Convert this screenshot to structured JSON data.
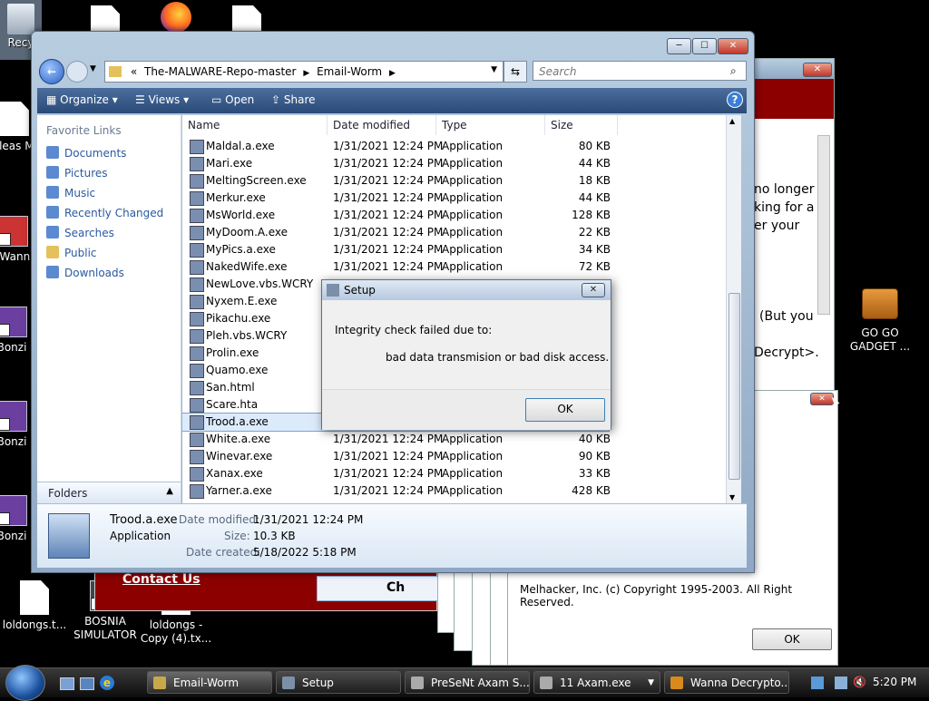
{
  "desktop": {
    "recycle_label": "Recy",
    "icons": [
      {
        "label": "!Pleas Me"
      },
      {
        "label": "!Wann"
      },
      {
        "label": "Bonzi"
      },
      {
        "label": "Bonzi"
      },
      {
        "label": "Bonzi"
      },
      {
        "label": "loldongs.t..."
      },
      {
        "label": "BOSNIA SIMULATOR"
      },
      {
        "label": "loldongs - Copy (4).tx..."
      },
      {
        "label": "GO GO GADGET ..."
      }
    ]
  },
  "explorer": {
    "breadcrumb": [
      "The-MALWARE-Repo-master",
      "Email-Worm"
    ],
    "search_placeholder": "Search",
    "toolbar": [
      "Organize",
      "Views",
      "Open",
      "Share"
    ],
    "favorite_links_title": "Favorite Links",
    "favorites": [
      "Documents",
      "Pictures",
      "Music",
      "Recently Changed",
      "Searches",
      "Public",
      "Downloads"
    ],
    "folders_label": "Folders",
    "columns": [
      "Name",
      "Date modified",
      "Type",
      "Size"
    ],
    "files": [
      {
        "name": "Maldal.a.exe",
        "date": "1/31/2021 12:24 PM",
        "type": "Application",
        "size": "80 KB"
      },
      {
        "name": "Mari.exe",
        "date": "1/31/2021 12:24 PM",
        "type": "Application",
        "size": "44 KB"
      },
      {
        "name": "MeltingScreen.exe",
        "date": "1/31/2021 12:24 PM",
        "type": "Application",
        "size": "18 KB"
      },
      {
        "name": "Merkur.exe",
        "date": "1/31/2021 12:24 PM",
        "type": "Application",
        "size": "44 KB"
      },
      {
        "name": "MsWorld.exe",
        "date": "1/31/2021 12:24 PM",
        "type": "Application",
        "size": "128 KB"
      },
      {
        "name": "MyDoom.A.exe",
        "date": "1/31/2021 12:24 PM",
        "type": "Application",
        "size": "22 KB"
      },
      {
        "name": "MyPics.a.exe",
        "date": "1/31/2021 12:24 PM",
        "type": "Application",
        "size": "34 KB"
      },
      {
        "name": "NakedWife.exe",
        "date": "1/31/2021 12:24 PM",
        "type": "Application",
        "size": "72 KB"
      },
      {
        "name": "NewLove.vbs.WCRY",
        "date": "",
        "type": "",
        "size": ""
      },
      {
        "name": "Nyxem.E.exe",
        "date": "",
        "type": "",
        "size": ""
      },
      {
        "name": "Pikachu.exe",
        "date": "",
        "type": "",
        "size": ""
      },
      {
        "name": "Pleh.vbs.WCRY",
        "date": "",
        "type": "",
        "size": ""
      },
      {
        "name": "Prolin.exe",
        "date": "",
        "type": "",
        "size": ""
      },
      {
        "name": "Quamo.exe",
        "date": "",
        "type": "",
        "size": ""
      },
      {
        "name": "San.html",
        "date": "",
        "type": "",
        "size": ""
      },
      {
        "name": "Scare.hta",
        "date": "",
        "type": "",
        "size": ""
      },
      {
        "name": "Trood.a.exe",
        "date": "",
        "type": "",
        "size": ""
      },
      {
        "name": "White.a.exe",
        "date": "1/31/2021 12:24 PM",
        "type": "Application",
        "size": "40 KB"
      },
      {
        "name": "Winevar.exe",
        "date": "1/31/2021 12:24 PM",
        "type": "Application",
        "size": "90 KB"
      },
      {
        "name": "Xanax.exe",
        "date": "1/31/2021 12:24 PM",
        "type": "Application",
        "size": "33 KB"
      },
      {
        "name": "Yarner.a.exe",
        "date": "1/31/2021 12:24 PM",
        "type": "Application",
        "size": "428 KB"
      }
    ],
    "selected_index": 16,
    "details": {
      "name": "Trood.a.exe",
      "type": "Application",
      "date_modified_label": "Date modified:",
      "date_modified": "1/31/2021 12:24 PM",
      "size_label": "Size:",
      "size": "10.3 KB",
      "date_created_label": "Date created:",
      "date_created": "5/18/2022 5:18 PM"
    }
  },
  "setup_dialog": {
    "title": "Setup",
    "line1": "Integrity check failed due to:",
    "line2": "bad data transmision or bad disk access.",
    "ok": "OK"
  },
  "background_windows": {
    "fragment1": "no longer",
    "fragment2": "king for a",
    "fragment3": "er your",
    "fragment4": "(But you",
    "fragment5": "Decrypt>.",
    "contact": "Contact Us",
    "copyright": "Melhacker, Inc. (c) Copyright 1995-2003. All Right Reserved.",
    "ok": "OK",
    "ch": "Ch"
  },
  "taskbar": {
    "items": [
      "Email-Worm",
      "Setup",
      "PreSeNt Axam S...",
      "11 Axam.exe",
      "Wanna Decrypto..."
    ],
    "clock": "5:20 PM"
  }
}
